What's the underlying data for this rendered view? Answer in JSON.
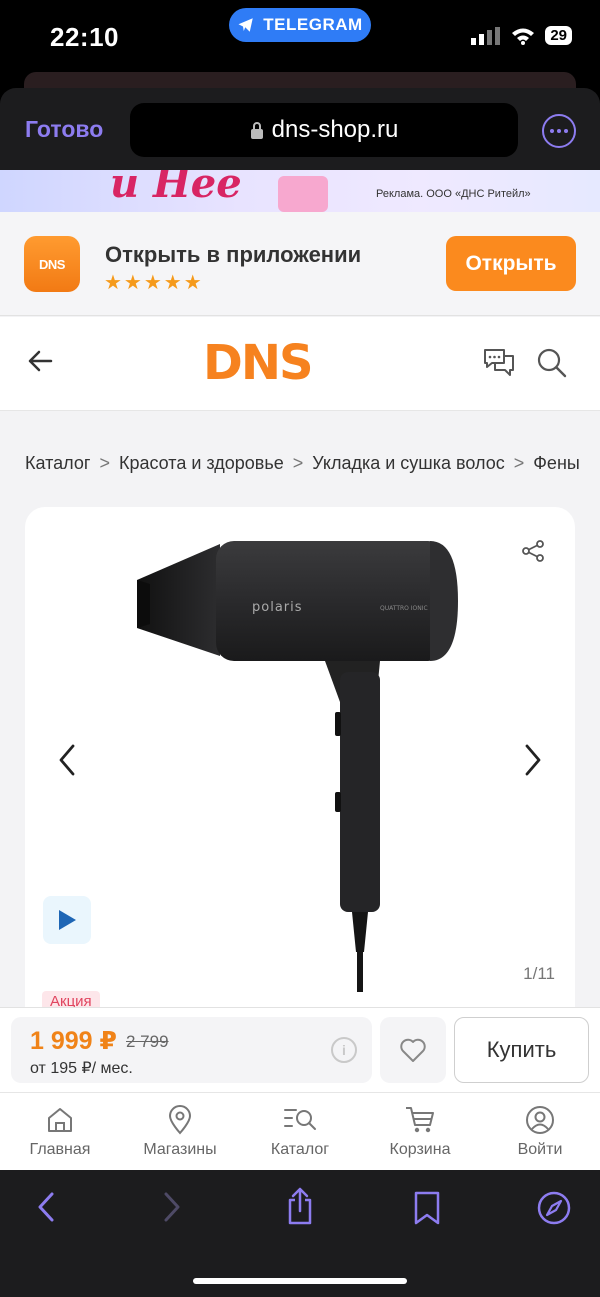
{
  "status_bar": {
    "time": "22:10",
    "app_pill": "TELEGRAM",
    "battery": "29"
  },
  "browser": {
    "done_label": "Готово",
    "url": "dns-shop.ru"
  },
  "ad_banner": {
    "headline": "и Нее",
    "disclaimer": "Реклама. ООО «ДНС Ритейл»"
  },
  "app_banner": {
    "logo_text": "DNS",
    "title": "Открыть в приложении",
    "rating": "★★★★★",
    "open_label": "Открыть"
  },
  "header": {
    "logo": "DNS"
  },
  "breadcrumb": [
    "Каталог",
    "Красота и здоровье",
    "Укладка и сушка волос",
    "Фены"
  ],
  "product": {
    "brand": "polaris",
    "series": "QUATTRO IONIC",
    "counter": "1/11",
    "promo_badge": "Акция",
    "price": "1 999 ₽",
    "old_price": "2 799",
    "installment": "от 195 ₽/ мес.",
    "buy_label": "Купить"
  },
  "tabbar": [
    {
      "label": "Главная",
      "icon": "home-icon"
    },
    {
      "label": "Магазины",
      "icon": "location-pin-icon"
    },
    {
      "label": "Каталог",
      "icon": "catalog-search-icon"
    },
    {
      "label": "Корзина",
      "icon": "cart-icon"
    },
    {
      "label": "Войти",
      "icon": "user-icon"
    }
  ],
  "colors": {
    "brand_orange": "#f6821f",
    "safari_accent": "#8d7cf0",
    "telegram_blue": "#2f7cf6"
  }
}
